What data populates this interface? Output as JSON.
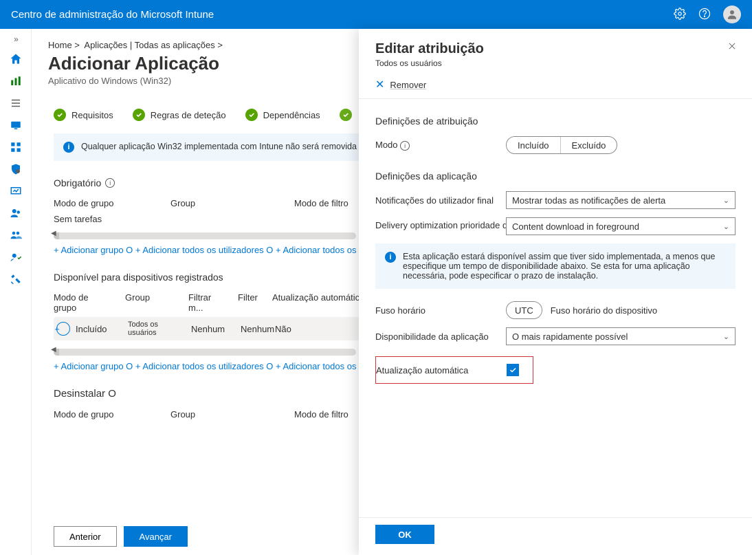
{
  "topbar": {
    "title": "Centro de administração do Microsoft Intune"
  },
  "breadcrumb": {
    "home": "Home >",
    "apps": "Aplicações | Todas as aplicações >"
  },
  "page": {
    "title": "Adicionar Aplicação",
    "subtitle": "Aplicativo do Windows (Win32)"
  },
  "steps": {
    "s1": "Requisitos",
    "s2": "Regras de deteção",
    "s3": "Dependências"
  },
  "infobox": "Qualquer aplicação Win32 implementada com Intune não será removida automaticamente do dispositivo f. Se a aplicação não for removida antes de extinguir o dispositivo, a",
  "required": {
    "title": "Obrigatório",
    "col_groupmode": "Modo de grupo",
    "col_group": "Group",
    "col_filtermode": "Modo de filtro",
    "notasks": "Sem tarefas",
    "addlinks": "+ Adicionar grupo O + Adicionar todos os utilizadores O + Adicionar todos os dispositivos O"
  },
  "available": {
    "title": "Disponível para dispositivos registrados",
    "c1": "Modo de grupo",
    "c2": "Group",
    "c3": "Filtrar m...",
    "c4": "Filter",
    "c5": "Atualização automática",
    "row_included": "Incluído",
    "row_group": "Todos os usuários",
    "row_fm": "Nenhum",
    "row_filter": "Nenhum",
    "row_auto": "Não",
    "addlinks": "+ Adicionar grupo O + Adicionar todos os utilizadores O + Adicionar todos os dispositivos O"
  },
  "uninstall": {
    "title": "Desinstalar O",
    "c1": "Modo de grupo",
    "c2": "Group",
    "c3": "Modo de filtro"
  },
  "footer": {
    "prev": "Anterior",
    "next": "Avançar"
  },
  "panel": {
    "title": "Editar atribuição",
    "subtitle": "Todos os usuários",
    "remove": "Remover",
    "sec1": "Definições de atribuição",
    "mode_label": "Modo",
    "mode_included": "Incluído",
    "mode_excluded": "Excluído",
    "sec2": "Definições da aplicação",
    "notif_label": "Notificações do utilizador final",
    "notif_value": "Mostrar todas as notificações de alerta",
    "deliv_label": "Delivery optimization prioridade do utilizador final",
    "deliv_value": "Content download in foreground",
    "infotext": "Esta aplicação estará disponível assim que tiver sido implementada, a menos que especifique um tempo de disponibilidade abaixo. Se esta for uma aplicação necessária, pode especificar o prazo de instalação.",
    "tz_label": "Fuso horário",
    "tz_utc": "UTC",
    "tz_device": "Fuso horário do dispositivo",
    "avail_label": "Disponibilidade da aplicação",
    "avail_value": "O mais rapidamente possível",
    "auto_label": "Atualização automática",
    "ok": "OK"
  }
}
